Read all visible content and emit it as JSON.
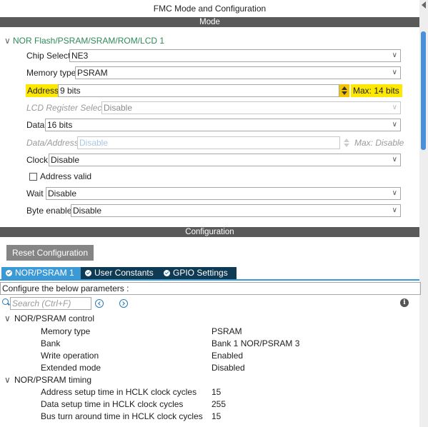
{
  "window": {
    "title": "FMC Mode and Configuration"
  },
  "mode": {
    "header": "Mode",
    "group": "NOR Flash/PSRAM/SRAM/ROM/LCD 1",
    "fields": {
      "chip_select": {
        "label": "Chip Select",
        "value": "NE3"
      },
      "memory_type": {
        "label": "Memory type",
        "value": "PSRAM"
      },
      "address": {
        "label": "Address",
        "value": "9 bits",
        "max": "Max: 14 bits"
      },
      "lcd_register_select": {
        "label": "LCD Register Select",
        "value": "Disable"
      },
      "data": {
        "label": "Data",
        "value": "16 bits"
      },
      "data_address": {
        "label": "Data/Address",
        "value": "Disable",
        "max": "Max: Disable"
      },
      "clock": {
        "label": "Clock",
        "value": "Disable"
      },
      "address_valid": {
        "label": "Address valid",
        "checked": false
      },
      "wait": {
        "label": "Wait",
        "value": "Disable"
      },
      "byte_enable": {
        "label": "Byte enable",
        "value": "Disable"
      }
    }
  },
  "configuration": {
    "header": "Configuration",
    "reset_button": "Reset Configuration",
    "tabs": [
      {
        "label": "NOR/PSRAM 1",
        "active": true
      },
      {
        "label": "User Constants",
        "active": false
      },
      {
        "label": "GPIO Settings",
        "active": false
      }
    ],
    "params_caption": "Configure the below parameters :",
    "search_placeholder": "Search (Ctrl+F)",
    "groups": [
      {
        "title": "NOR/PSRAM control",
        "params": [
          {
            "name": "Memory type",
            "value": "PSRAM"
          },
          {
            "name": "Bank",
            "value": "Bank 1 NOR/PSRAM 3"
          },
          {
            "name": "Write operation",
            "value": "Enabled"
          },
          {
            "name": "Extended mode",
            "value": "Disabled"
          }
        ]
      },
      {
        "title": "NOR/PSRAM timing",
        "params": [
          {
            "name": "Address setup time in HCLK clock cycles",
            "value": "15"
          },
          {
            "name": "Data setup time in HCLK clock cycles",
            "value": "255"
          },
          {
            "name": "Bus turn around time in HCLK clock cycles",
            "value": "15"
          }
        ]
      }
    ]
  },
  "colors": {
    "accent": "#3b9ad6",
    "tab_inactive": "#0f3a54",
    "highlight": "#ffe800",
    "group_green": "#2e8b57",
    "bar_gray": "#5a5a5a"
  },
  "icons": [
    "chevron-down-icon",
    "spinner-icon",
    "checkbox-icon",
    "check-circle-icon",
    "search-icon",
    "prev-icon",
    "next-icon",
    "info-icon"
  ]
}
